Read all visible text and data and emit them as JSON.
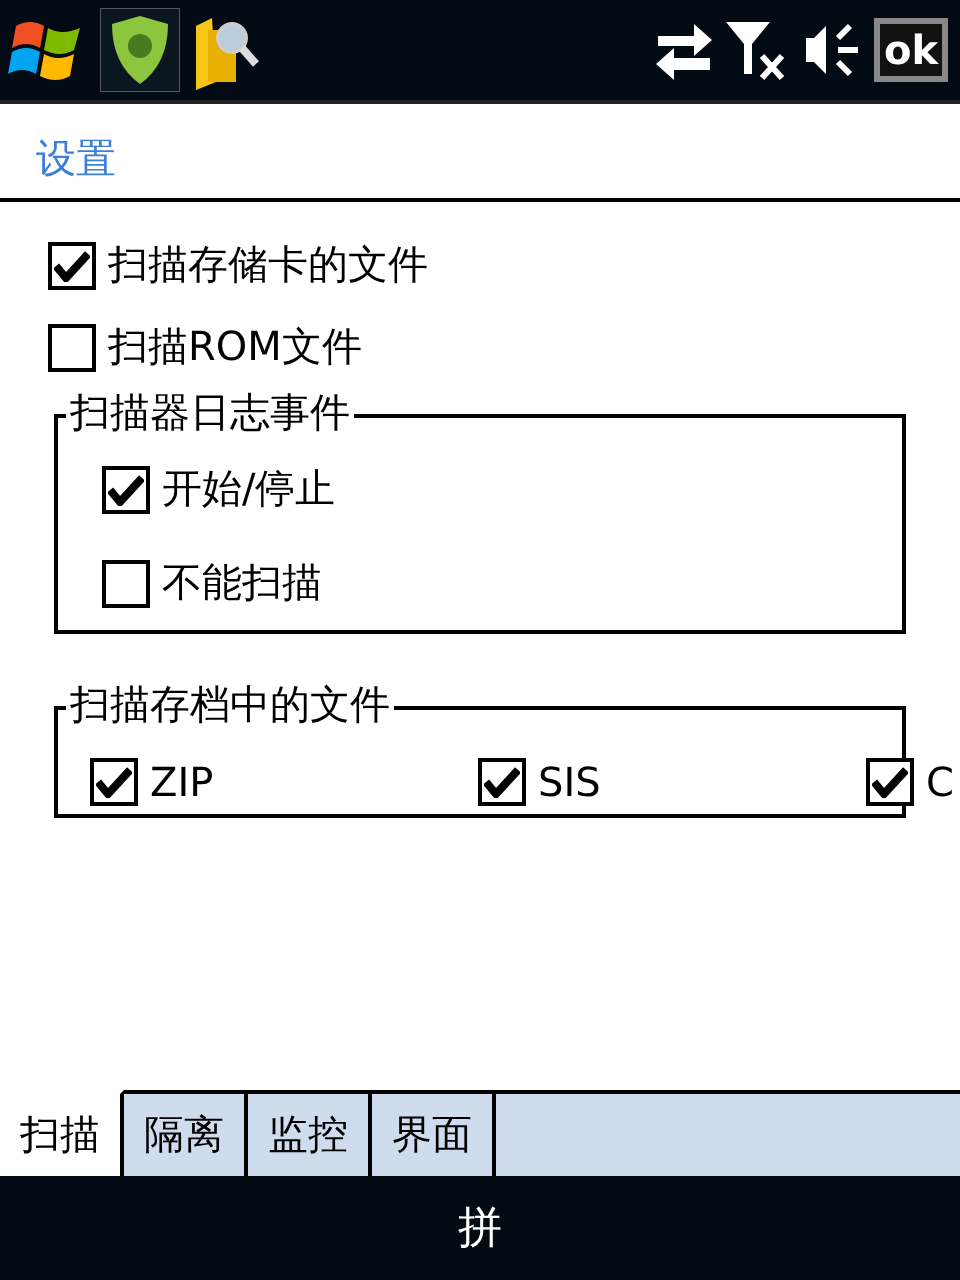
{
  "status_bar": {
    "ok_label": "ok"
  },
  "title": "设置",
  "options": [
    {
      "label": "扫描存储卡的文件",
      "checked": true
    },
    {
      "label": "扫描ROM文件",
      "checked": false
    }
  ],
  "log_group": {
    "title": "扫描器日志事件",
    "items": [
      {
        "label": "开始/停止",
        "checked": true
      },
      {
        "label": "不能扫描",
        "checked": false
      }
    ]
  },
  "archive_group": {
    "title": "扫描存档中的文件",
    "items": [
      {
        "label": "ZIP",
        "checked": true
      },
      {
        "label": "SIS",
        "checked": true
      },
      {
        "label": "C",
        "checked": true
      }
    ]
  },
  "tabs": [
    {
      "label": "扫描",
      "selected": true
    },
    {
      "label": "隔离",
      "selected": false
    },
    {
      "label": "监控",
      "selected": false
    },
    {
      "label": "界面",
      "selected": false
    }
  ],
  "input_method": "拼"
}
